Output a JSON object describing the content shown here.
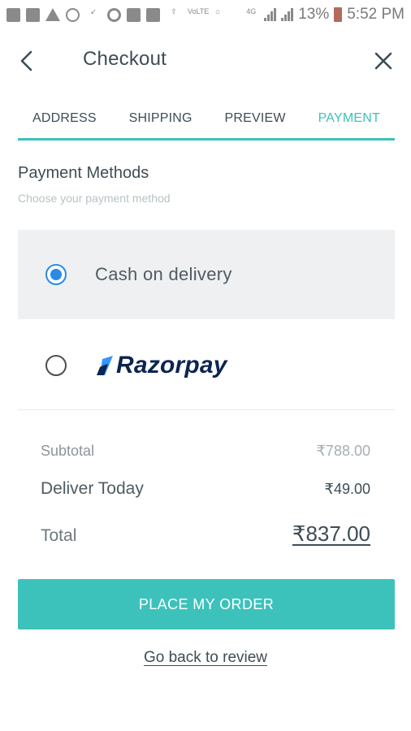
{
  "status_bar": {
    "battery_percent": "13%",
    "time": "5:52 PM",
    "left_icons": [
      "notification-icon",
      "mail-icon",
      "warning-icon",
      "whatsapp-icon",
      "missed-call-icon",
      "google-icon",
      "image-icon",
      "email-icon",
      "upload-icon",
      "volte-icon",
      "home-icon"
    ],
    "right_icons": [
      "4g-icon",
      "signal-icon",
      "signal-icon",
      "battery-icon"
    ],
    "network_label": "4G"
  },
  "header": {
    "title": "Checkout",
    "back_icon": "chevron-left-icon",
    "close_icon": "close-icon"
  },
  "tabs": [
    {
      "label": "ADDRESS",
      "active": false
    },
    {
      "label": "SHIPPING",
      "active": false
    },
    {
      "label": "PREVIEW",
      "active": false
    },
    {
      "label": "PAYMENT",
      "active": true
    }
  ],
  "payment": {
    "title": "Payment Methods",
    "subtitle": "Choose your payment method",
    "options": [
      {
        "label": "Cash on delivery",
        "selected": true
      },
      {
        "label": "Razorpay",
        "selected": false
      }
    ]
  },
  "summary": {
    "subtotal_label": "Subtotal",
    "subtotal_value": "₹788.00",
    "delivery_label": "Deliver Today",
    "delivery_value": "₹49.00",
    "total_label": "Total",
    "total_value": "₹837.00"
  },
  "actions": {
    "place_order": "PLACE MY ORDER",
    "back_to_review": "Go back to review"
  },
  "colors": {
    "accent": "#3cc2bb",
    "radio_selected": "#2a8be6",
    "razorpay_blue": "#0c2451",
    "razorpay_light": "#3395ff"
  }
}
